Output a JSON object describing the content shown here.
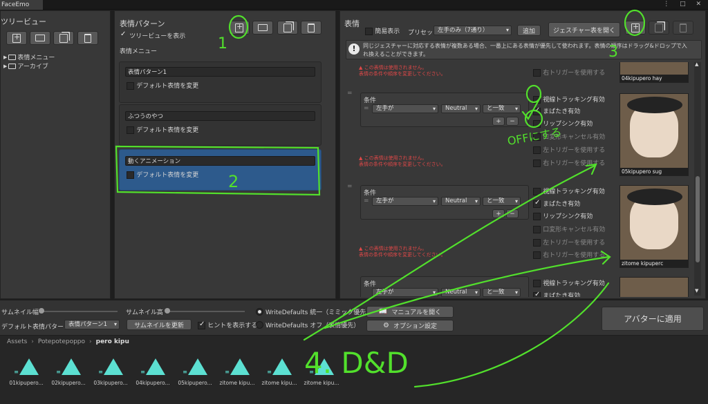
{
  "window": {
    "title": "FaceEmo",
    "controls": "⋮ □ ✕"
  },
  "tree_panel": {
    "title": "ツリービュー",
    "items": [
      {
        "label": "表情メニュー"
      },
      {
        "label": "アーカイブ"
      }
    ]
  },
  "pattern_panel": {
    "title": "表情パターン",
    "show_tree_label": "ツリービューを表示",
    "menu_label": "表情メニュー",
    "patterns": [
      {
        "name": "表情パターン1",
        "default_label": "デフォルト表情を変更"
      },
      {
        "name": "ふつうのやつ",
        "default_label": "デフォルト表情を変更"
      },
      {
        "name": "動くアニメーション",
        "default_label": "デフォルト表情を変更"
      }
    ]
  },
  "expression_panel": {
    "title": "表情",
    "simple_display_label": "簡易表示",
    "preset_label": "プリセット",
    "preset_value": "左手のみ（7通り）",
    "add_button": "追加",
    "gesture_table_button": "ジェスチャー表を開く",
    "info_text_1": "同じジェスチャーに対応する表情が複数ある場合、一番上にある表情が優先して使われます。表情の順序はドラッグ&ドロップで入",
    "info_text_2": "れ換えることができます。",
    "warning_1": "▲ この表情は使用されません。",
    "warning_2": "表情の条件や順序を変更してください。",
    "condition_label": "条件",
    "hand_value": "左手が",
    "gesture_value": "Neutral",
    "match_value": "と一致",
    "plus": "+",
    "minus": "−",
    "options": {
      "right_trigger": "右トリガーを使用する",
      "left_trigger": "左トリガーを使用する",
      "eye_tracking": "視線トラッキング有効",
      "blink": "まばたき有効",
      "lip_sync": "リップシンク有効",
      "mouth_cancel": "口変形キャンセル有効"
    },
    "thumbnails": [
      {
        "caption": "04kipupero hay"
      },
      {
        "caption": "05kipupero sug"
      },
      {
        "caption": "zitome kipuperc"
      }
    ]
  },
  "bottom_bar": {
    "thumb_width_label": "サムネイル幅",
    "thumb_height_label": "サムネイル高",
    "default_pattern_label": "デフォルト表情パターン",
    "default_pattern_value": "表情パターン1",
    "refresh_thumb_button": "サムネイルを更新",
    "show_hints_label": "ヒントを表示する",
    "write_defaults_on": "WriteDefaults 統一（ミミック優先）",
    "write_defaults_off": "WriteDefaults オフ（表情優先）",
    "manual_button": "マニュアルを開く",
    "options_button": "オプション設定",
    "apply_button": "アバターに適用"
  },
  "assets": {
    "breadcrumb": [
      "Assets",
      "Potepotepoppo",
      "pero kipu"
    ],
    "files": [
      "01kipupero...",
      "02kipupero...",
      "03kipupero...",
      "04kipupero...",
      "05kipupero...",
      "zitome kipu...",
      "zitome kipu...",
      "zitome kipu..."
    ]
  },
  "annotations": {
    "step1": "1",
    "step2": "2",
    "step3": "3",
    "step4": "4. D&D",
    "off_note": "OFFにする"
  },
  "colors": {
    "accent_green": "#52e02c",
    "selected_blue": "#2d5a8c",
    "warning_red": "#e04848",
    "asset_teal": "#5ce0d2"
  }
}
